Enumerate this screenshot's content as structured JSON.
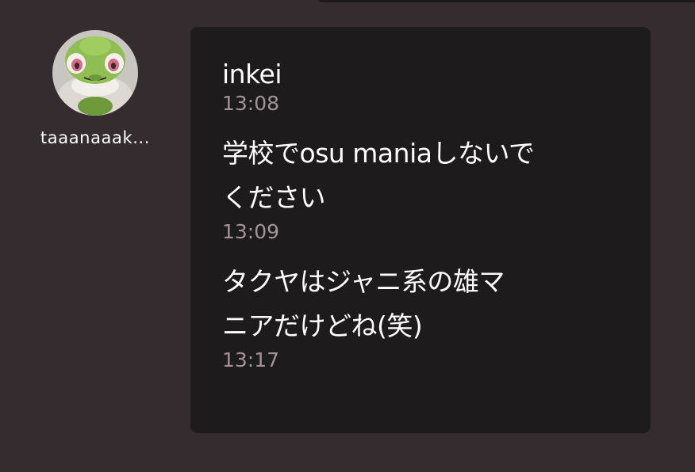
{
  "sender": {
    "name": "taaanaaak...",
    "avatar": "frog-plush-avatar"
  },
  "messages": [
    {
      "text": "inkei",
      "time": "13:08"
    },
    {
      "text": "学校でosu maniaしないで\nください",
      "time": "13:09"
    },
    {
      "text": "タクヤはジャニ系の雄マ\nニアだけどね(笑)",
      "time": "13:17"
    }
  ],
  "colors": {
    "background": "#352c30",
    "bubble": "#1e1b1c",
    "text": "#ffffff",
    "timestamp": "#a2949a"
  }
}
